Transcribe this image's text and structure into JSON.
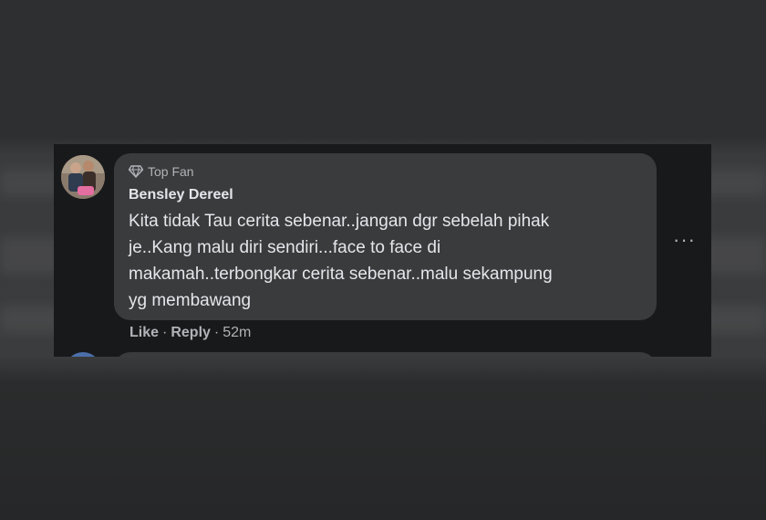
{
  "comment": {
    "badge_label": "Top Fan",
    "author": "Bensley Dereel",
    "text_lines": [
      "Kita tidak Tau cerita sebenar..jangan dgr sebelah pihak",
      "je..Kang malu diri sendiri...face to face di",
      "makamah..terbongkar cerita sebenar..malu sekampung",
      "yg membawang"
    ],
    "more_label": "···",
    "actions": {
      "like": "Like",
      "reply": "Reply",
      "separator": "·",
      "time": "52m"
    }
  },
  "icons": {
    "badge": "diamond-icon",
    "more": "more-options-icon"
  },
  "colors": {
    "panel_bg": "#18191a",
    "bubble_bg": "#3a3b3c",
    "primary_text": "#e4e6eb",
    "secondary_text": "#b0b3b8"
  }
}
